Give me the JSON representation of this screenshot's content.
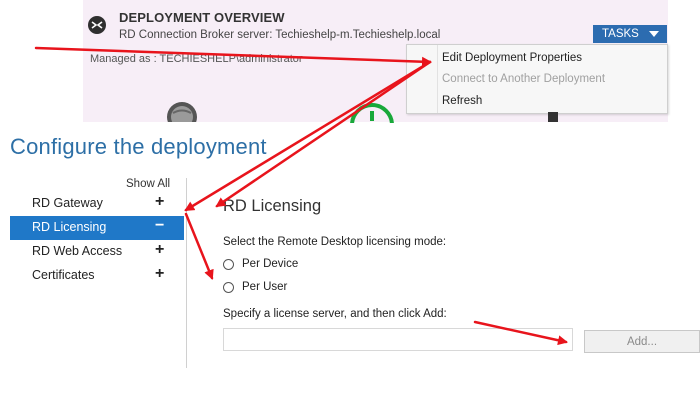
{
  "overview": {
    "title": "DEPLOYMENT OVERVIEW",
    "broker": "RD Connection Broker server: Techieshelp-m.Techieshelp.local",
    "managed": "Managed as : TECHIESHELP\\administrator",
    "tasks_label": "TASKS"
  },
  "tasks_menu": {
    "items": [
      {
        "label": "Edit Deployment Properties",
        "enabled": true
      },
      {
        "label": "Connect to Another Deployment",
        "enabled": false
      },
      {
        "label": "Refresh",
        "enabled": true
      }
    ]
  },
  "page": {
    "title": "Configure the deployment",
    "show_all": "Show All"
  },
  "sidebar": {
    "items": [
      {
        "label": "RD Gateway",
        "symbol": "+",
        "selected": false
      },
      {
        "label": "RD Licensing",
        "symbol": "−",
        "selected": true
      },
      {
        "label": "RD Web Access",
        "symbol": "+",
        "selected": false
      },
      {
        "label": "Certificates",
        "symbol": "+",
        "selected": false
      }
    ]
  },
  "licensing": {
    "heading": "RD Licensing",
    "mode_label": "Select the Remote Desktop licensing mode:",
    "options": [
      {
        "label": "Per Device",
        "checked": false
      },
      {
        "label": "Per User",
        "checked": false
      }
    ],
    "server_label": "Specify a license server, and then click Add:",
    "server_value": "",
    "add_label": "Add..."
  },
  "colors": {
    "accent": "#2c6cb0",
    "selection": "#1f78c8",
    "title": "#2d6fa6",
    "arrow": "#e8141c"
  }
}
